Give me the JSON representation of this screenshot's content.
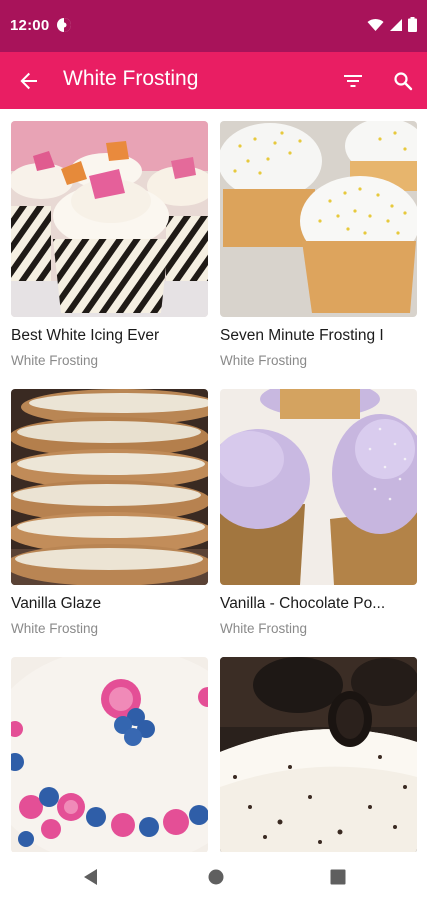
{
  "status_bar": {
    "time": "12:00",
    "icons": [
      "app-notification-icon",
      "wifi-icon",
      "signal-icon",
      "battery-icon"
    ]
  },
  "app_bar": {
    "title": "White Frosting",
    "color": "#e91e63",
    "status_color": "#a8135a",
    "icons": [
      "arrow-back-icon",
      "filter-icon",
      "search-icon"
    ]
  },
  "recipes": [
    {
      "title": "Best White Icing Ever",
      "category": "White Frosting"
    },
    {
      "title": "Seven Minute Frosting I",
      "category": "White Frosting"
    },
    {
      "title": "Vanilla Glaze",
      "category": "White Frosting"
    },
    {
      "title": "Vanilla - Chocolate Po...",
      "category": "White Frosting"
    },
    {
      "title": "",
      "category": ""
    },
    {
      "title": "",
      "category": ""
    }
  ],
  "nav_bar": {
    "icons": [
      "nav-back-icon",
      "nav-home-icon",
      "nav-recents-icon"
    ]
  }
}
